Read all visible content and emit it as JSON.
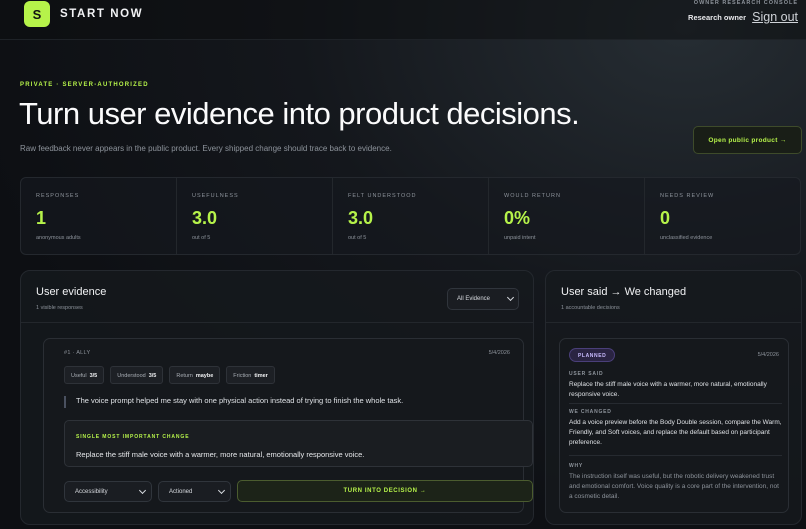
{
  "header": {
    "logo_letter": "S",
    "brand": "START NOW",
    "console_label": "OWNER RESEARCH CONSOLE",
    "owner_label": "Research owner",
    "signout_label": "Sign out"
  },
  "hero": {
    "kicker": "PRIVATE · SERVER-AUTHORIZED",
    "title": "Turn user evidence into product decisions.",
    "subtitle": "Raw feedback never appears in the public product. Every shipped change should trace back to evidence.",
    "open_button": "Open public product →"
  },
  "stats": [
    {
      "label": "RESPONSES",
      "value": "1",
      "note": "anonymous adults"
    },
    {
      "label": "USEFULNESS",
      "value": "3.0",
      "note": "out of 5"
    },
    {
      "label": "FELT UNDERSTOOD",
      "value": "3.0",
      "note": "out of 5"
    },
    {
      "label": "WOULD RETURN",
      "value": "0%",
      "note": "unpaid intent"
    },
    {
      "label": "NEEDS REVIEW",
      "value": "0",
      "note": "unclassified evidence"
    }
  ],
  "evidence": {
    "title": "User evidence",
    "subtitle": "1 visible responses",
    "filter_value": "All Evidence",
    "card": {
      "id": "#1 · ALLY",
      "date": "5/4/2026",
      "chips": [
        {
          "label": "Useful",
          "value": "3/5"
        },
        {
          "label": "Understood",
          "value": "3/5"
        },
        {
          "label": "Return",
          "value": "maybe"
        },
        {
          "label": "Friction",
          "value": "timer"
        }
      ],
      "quote": "The voice prompt helped me stay with one physical action instead of trying to finish the whole task.",
      "important_label": "SINGLE MOST IMPORTANT CHANGE",
      "important_text": "Replace the stiff male voice with a warmer, more natural, emotionally responsive voice.",
      "category_value": "Accessibility",
      "status_value": "Actioned",
      "decision_button": "TURN INTO DECISION →"
    }
  },
  "changes": {
    "title": "User said → We changed",
    "subtitle": "1 accountable decisions",
    "card": {
      "badge": "PLANNED",
      "date": "5/4/2026",
      "user_said_label": "USER SAID",
      "user_said": "Replace the stiff male voice with a warmer, more natural, emotionally responsive voice.",
      "we_changed_label": "WE CHANGED",
      "we_changed": "Add a voice preview before the Body Double session, compare the Warm, Friendly, and Soft voices, and replace the default based on participant preference.",
      "why_label": "WHY",
      "why": "The instruction itself was useful, but the robotic delivery weakened trust and emotional comfort. Voice quality is a core part of the intervention, not a cosmetic detail."
    }
  },
  "colors": {
    "accent": "#b6f34a",
    "background": "#0d0f13",
    "planned_badge": "#2a2442"
  }
}
